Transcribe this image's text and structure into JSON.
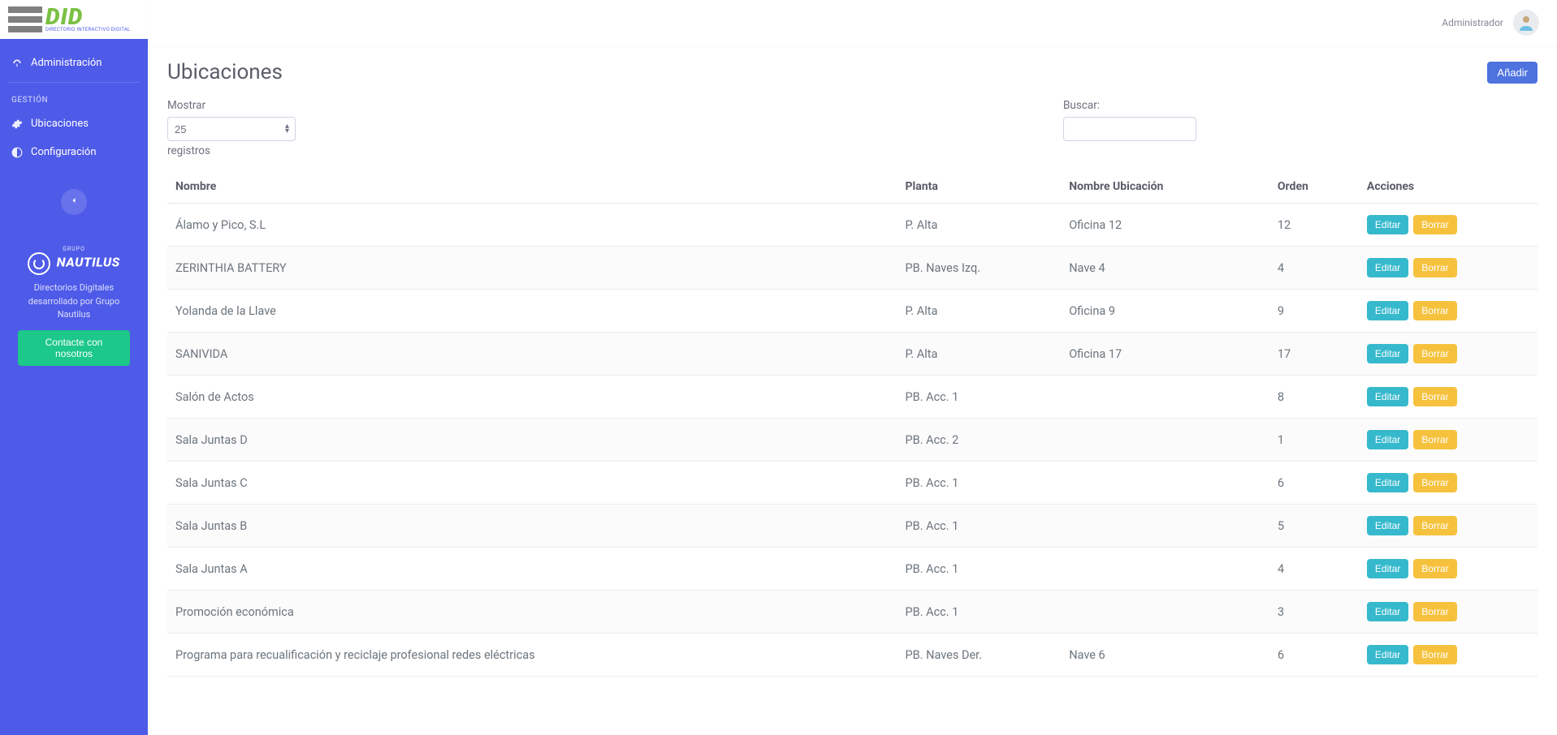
{
  "brand": {
    "main": "DID",
    "sub": "DIRECTORIO INTERACTIVO DIGITAL"
  },
  "sidebar": {
    "admin_label": "Administración",
    "section_heading": "GESTIÓN",
    "items": [
      {
        "label": "Ubicaciones"
      },
      {
        "label": "Configuración"
      }
    ],
    "promo": {
      "group_top": "GRUPO",
      "group_name": "NAUTILUS",
      "text": "Directorios Digitales desarrollado por Grupo Nautilus",
      "cta": "Contacte con nosotros"
    }
  },
  "topbar": {
    "user": "Administrador"
  },
  "page": {
    "title": "Ubicaciones",
    "add_label": "Añadir"
  },
  "controls": {
    "show_label": "Mostrar",
    "show_value": "25",
    "records_label": "registros",
    "search_label": "Buscar:"
  },
  "table": {
    "headers": {
      "nombre": "Nombre",
      "planta": "Planta",
      "ubicacion": "Nombre Ubicación",
      "orden": "Orden",
      "acciones": "Acciones"
    },
    "actions": {
      "edit": "Editar",
      "delete": "Borrar"
    },
    "rows": [
      {
        "nombre": "Álamo y Pico, S.L",
        "planta": "P. Alta",
        "ubicacion": "Oficina 12",
        "orden": "12"
      },
      {
        "nombre": "ZERINTHIA BATTERY",
        "planta": "PB. Naves Izq.",
        "ubicacion": "Nave 4",
        "orden": "4"
      },
      {
        "nombre": "Yolanda de la Llave",
        "planta": "P. Alta",
        "ubicacion": "Oficina 9",
        "orden": "9"
      },
      {
        "nombre": "SANIVIDA",
        "planta": "P. Alta",
        "ubicacion": "Oficina 17",
        "orden": "17"
      },
      {
        "nombre": "Salón de Actos",
        "planta": "PB. Acc. 1",
        "ubicacion": "",
        "orden": "8"
      },
      {
        "nombre": "Sala Juntas D",
        "planta": "PB. Acc. 2",
        "ubicacion": "",
        "orden": "1"
      },
      {
        "nombre": "Sala Juntas C",
        "planta": "PB. Acc. 1",
        "ubicacion": "",
        "orden": "6"
      },
      {
        "nombre": "Sala Juntas B",
        "planta": "PB. Acc. 1",
        "ubicacion": "",
        "orden": "5"
      },
      {
        "nombre": "Sala Juntas A",
        "planta": "PB. Acc. 1",
        "ubicacion": "",
        "orden": "4"
      },
      {
        "nombre": "Promoción económica",
        "planta": "PB. Acc. 1",
        "ubicacion": "",
        "orden": "3"
      },
      {
        "nombre": "Programa para recualificación y reciclaje profesional redes eléctricas",
        "planta": "PB. Naves Der.",
        "ubicacion": "Nave 6",
        "orden": "6"
      }
    ]
  }
}
